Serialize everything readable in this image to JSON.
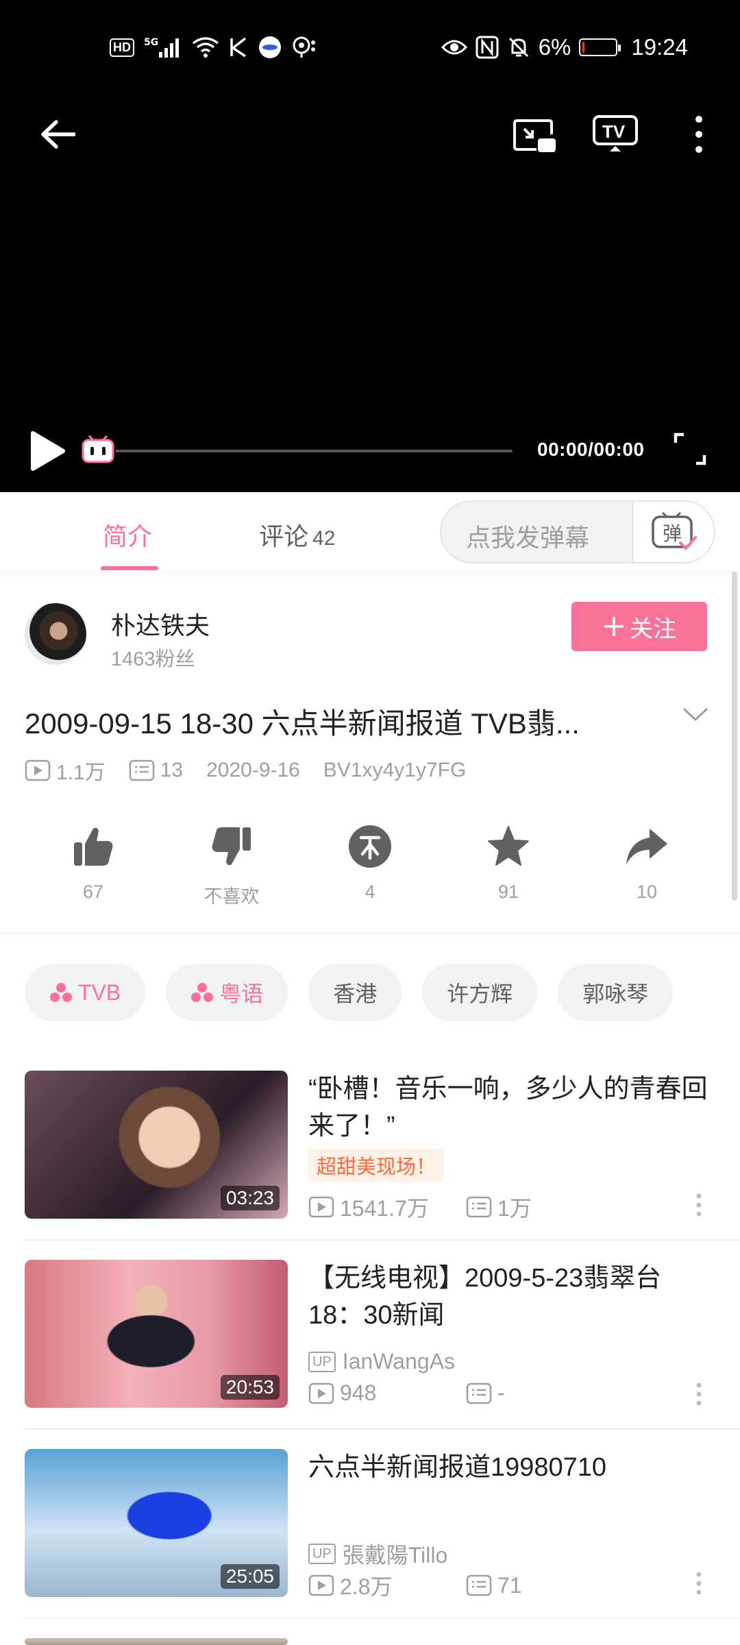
{
  "status_bar": {
    "left_icons": [
      "hd-icon",
      "5g-signal-icon",
      "wifi-icon",
      "k-icon",
      "app-icon",
      "hotspot-icon"
    ],
    "battery_percent": "6%",
    "battery_level": 0.06,
    "time": "19:24"
  },
  "player": {
    "time_display": "00:00/00:00",
    "progress": 0
  },
  "tabs": {
    "intro_label": "简介",
    "comments_label": "评论",
    "comments_count": "42",
    "danmaku_placeholder": "点我发弹幕",
    "danmaku_btn_glyph": "弹"
  },
  "author": {
    "name": "朴达铁夫",
    "fans": "1463粉丝",
    "follow_label": "关注"
  },
  "video": {
    "title": "2009-09-15 18-30 六点半新闻报道 TVB翡...",
    "views": "1.1万",
    "danmaku_count": "13",
    "date": "2020-9-16",
    "bvid": "BV1xy4y1y7FG"
  },
  "actions": {
    "like": "67",
    "dislike": "不喜欢",
    "coin": "4",
    "favorite": "91",
    "share": "10"
  },
  "tags": [
    "TVB",
    "粤语",
    "香港",
    "许方辉",
    "郭咏琴"
  ],
  "related": [
    {
      "title": "“卧槽！音乐一响，多少人的青春回来了！”",
      "badge": "超甜美现场！",
      "duration": "03:23",
      "views": "1541.7万",
      "danmaku": "1万"
    },
    {
      "title": "【无线电视】2009-5-23翡翠台18：30新闻",
      "uploader": "IanWangAs",
      "duration": "20:53",
      "views": "948",
      "danmaku": "-"
    },
    {
      "title": "六点半新闻报道19980710",
      "uploader": "張戴陽Tillo",
      "duration": "25:05",
      "views": "2.8万",
      "danmaku": "71"
    }
  ],
  "colors": {
    "accent": "#fb7299",
    "badge_text": "#ff6a3a",
    "battery_low": "#e53935"
  }
}
